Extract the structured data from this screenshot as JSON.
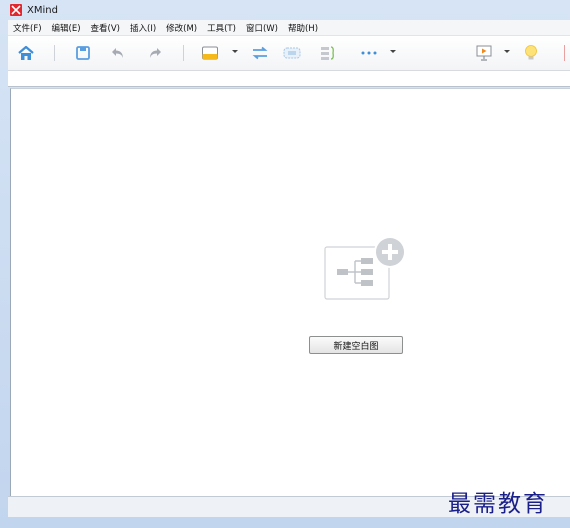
{
  "window": {
    "title": "XMind"
  },
  "menu": {
    "items": [
      "文件(F)",
      "编辑(E)",
      "查看(V)",
      "插入(I)",
      "修改(M)",
      "工具(T)",
      "窗口(W)",
      "帮助(H)"
    ]
  },
  "toolbar": {
    "icons": [
      "home-icon",
      "save-icon",
      "undo-icon",
      "redo-icon",
      "topic-icon",
      "relationship-icon",
      "boundary-icon",
      "summary-icon",
      "more-icon",
      "presentation-icon",
      "idea-icon"
    ]
  },
  "main": {
    "new_blank_map_label": "新建空白图"
  },
  "watermark": {
    "text": "最需教育"
  },
  "colors": {
    "accent_blue": "#3f8fd8",
    "topic_orange": "#f5b91c",
    "brand_red": "#e0282e"
  }
}
